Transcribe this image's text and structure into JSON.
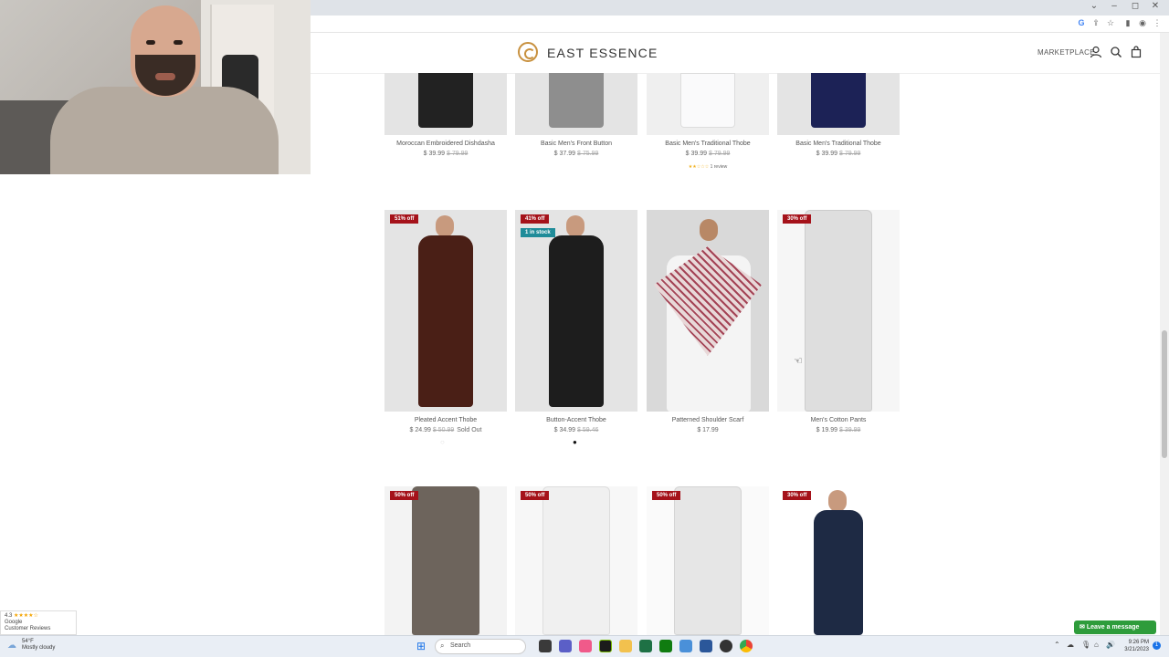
{
  "browser": {
    "window_controls": [
      "⌄",
      "–",
      "◻",
      "✕"
    ]
  },
  "site": {
    "logo_text": "EAST ESSENCE",
    "marketplace_label": "MARKETPLACE",
    "brand_color": "#c8913f"
  },
  "top_row": [
    {
      "name": "Moroccan Embroidered Dishdasha",
      "price": "$ 39.99",
      "old_price": "$ 79.99",
      "robe_color": "#222222"
    },
    {
      "name": "Basic Men's Front Button",
      "price": "$ 37.99",
      "old_price": "$ 75.99",
      "robe_color": "#8e8e8e"
    },
    {
      "name": "Basic Men's Traditional Thobe",
      "price": "$ 39.99",
      "old_price": "$ 79.99",
      "robe_color": "#e9e9ec",
      "review": "1 review",
      "rating": 2
    },
    {
      "name": "Basic Men's Traditional Thobe",
      "price": "$ 39.99",
      "old_price": "$ 79.99",
      "robe_color": "#1c2256"
    }
  ],
  "middle_row": [
    {
      "name": "Pleated Accent Thobe",
      "price": "$ 24.99",
      "old_price": "$ 50.99",
      "status": "Sold Out",
      "badge": "51% off",
      "robe_color": "#4a1f16"
    },
    {
      "name": "Button-Accent Thobe",
      "price": "$ 34.99",
      "old_price": "$ 59.46",
      "badge": "41% off",
      "stock_badge": "1 in stock",
      "robe_color": "#1d1d1d"
    },
    {
      "name": "Patterned Shoulder Scarf",
      "price": "$ 17.99",
      "robe_color": "#f4f4f4"
    },
    {
      "name": "Men's Cotton Pants",
      "price": "$ 19.99",
      "old_price": "$ 39.99",
      "badge": "30% off",
      "robe_color": "#dedede"
    }
  ],
  "bottom_row": [
    {
      "badge": "50% off",
      "color": "#6d645c"
    },
    {
      "badge": "50% off",
      "color": "#f0f0f0"
    },
    {
      "badge": "50% off",
      "color": "#e6e6e6"
    },
    {
      "badge": "30% off",
      "color": "#1e2a44"
    }
  ],
  "google_reviews": {
    "rating": "4.3",
    "stars": "★★★★☆",
    "source": "Google",
    "label": "Customer Reviews"
  },
  "chat": {
    "label": "Leave a message"
  },
  "taskbar": {
    "weather_temp": "54°F",
    "weather_desc": "Mostly cloudy",
    "search_placeholder": "Search",
    "time": "9:26 PM",
    "date": "3/21/2023"
  }
}
